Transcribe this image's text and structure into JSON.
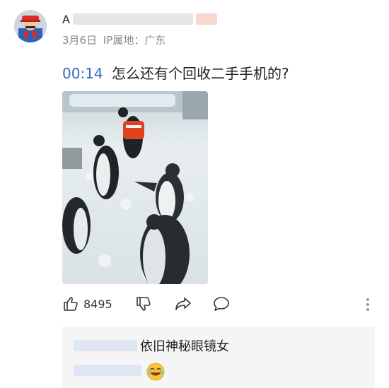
{
  "comment": {
    "username_visible": "A",
    "date": "3月6日",
    "ip_location": "IP属地：广东",
    "timestamp": "00:14",
    "text": "怎么还有个回收二手手机的?"
  },
  "actions": {
    "like_count": "8495"
  },
  "reply": {
    "text": "依旧神秘眼镜女"
  },
  "colors": {
    "timestamp_accent": "#2f6cbf",
    "meta_gray": "#8a8a8a",
    "reply_bg": "#f5f5f5"
  },
  "icons": [
    "thumbs-up-icon",
    "thumbs-down-icon",
    "share-icon",
    "comment-icon",
    "more-icon",
    "laughing-emoji-icon"
  ]
}
